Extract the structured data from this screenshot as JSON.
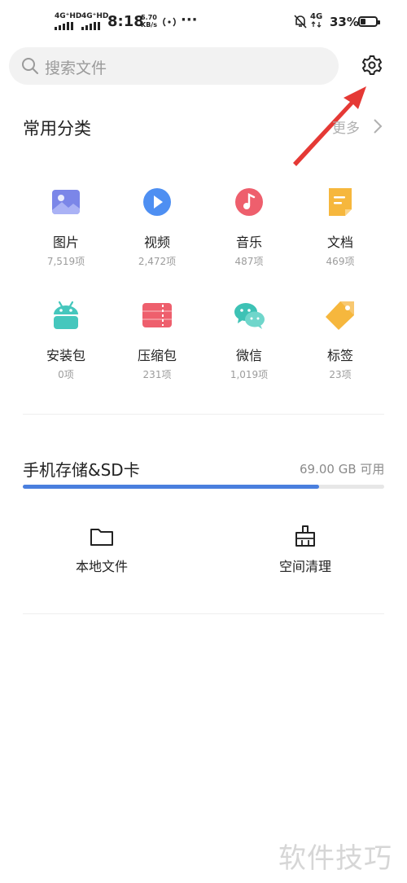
{
  "status_bar": {
    "signal1": "4G⁺HD",
    "signal2": "4G⁺HD",
    "time": "8:18",
    "speed_value": "5.70",
    "speed_unit": "KB/s",
    "network_small": "4G",
    "battery": "33%",
    "battery_level": 0.33
  },
  "search": {
    "placeholder": "搜索文件"
  },
  "categories_section": {
    "title": "常用分类",
    "more": "更多",
    "items": [
      {
        "name": "图片",
        "count": "7,519项",
        "icon": "image-icon",
        "color": "#7b86e8"
      },
      {
        "name": "视频",
        "count": "2,472项",
        "icon": "video-icon",
        "color": "#4e8ff2"
      },
      {
        "name": "音乐",
        "count": "487项",
        "icon": "music-icon",
        "color": "#ee5f6d"
      },
      {
        "name": "文档",
        "count": "469项",
        "icon": "document-icon",
        "color": "#f6b73d"
      },
      {
        "name": "安装包",
        "count": "0项",
        "icon": "android-package-icon",
        "color": "#45c7bd"
      },
      {
        "name": "压缩包",
        "count": "231项",
        "icon": "archive-icon",
        "color": "#ee5f6d"
      },
      {
        "name": "微信",
        "count": "1,019项",
        "icon": "wechat-icon",
        "color": "#3dc2b5"
      },
      {
        "name": "标签",
        "count": "23项",
        "icon": "tag-icon",
        "color": "#f6b73d"
      }
    ]
  },
  "storage": {
    "title": "手机存储&SD卡",
    "free": "69.00 GB 可用",
    "used_fraction": 0.82,
    "bar_color": "#4a7fde"
  },
  "tools": [
    {
      "label": "本地文件",
      "icon": "folder-icon"
    },
    {
      "label": "空间清理",
      "icon": "broom-icon"
    }
  ],
  "watermark": "软件技巧",
  "annotation_color": "#e53935"
}
